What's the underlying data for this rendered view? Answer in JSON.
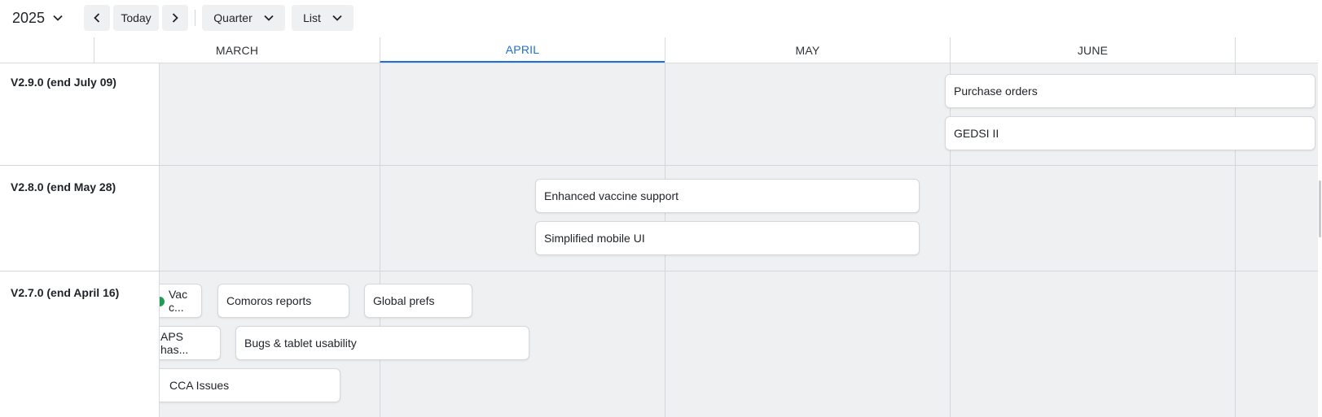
{
  "toolbar": {
    "year_label": "2025",
    "today_label": "Today",
    "period_label": "Quarter",
    "view_label": "List",
    "icons": {
      "year_dropdown": "chevron-down-icon",
      "prev": "chevron-left-icon",
      "next": "chevron-right-icon"
    }
  },
  "months": [
    {
      "label": "MARCH",
      "active": false
    },
    {
      "label": "APRIL",
      "active": true
    },
    {
      "label": "MAY",
      "active": false
    },
    {
      "label": "JUNE",
      "active": false
    }
  ],
  "rows": [
    {
      "label": "V2.9.0 (end July 09)"
    },
    {
      "label": "V2.8.0 (end May 28)"
    },
    {
      "label": "V2.7.0 (end April 16)"
    }
  ],
  "cards": {
    "purchase_orders": "Purchase orders",
    "gedsi": "GEDSI II",
    "enhanced_vaccine": "Enhanced vaccine support",
    "simplified_mobile": "Simplified mobile UI",
    "vac_line1": "Vac",
    "vac_line2": "c...",
    "comoros": "Comoros reports",
    "global_prefs": "Global prefs",
    "aps_line1": "APS",
    "aps_line2": "has...",
    "bugs_tablet": "Bugs & tablet usability",
    "cca_issues": "CCA Issues"
  },
  "colors": {
    "accent": "#1e6fd9",
    "lane_bg": "#eef0f2",
    "status_dot": "#1f9d55"
  }
}
